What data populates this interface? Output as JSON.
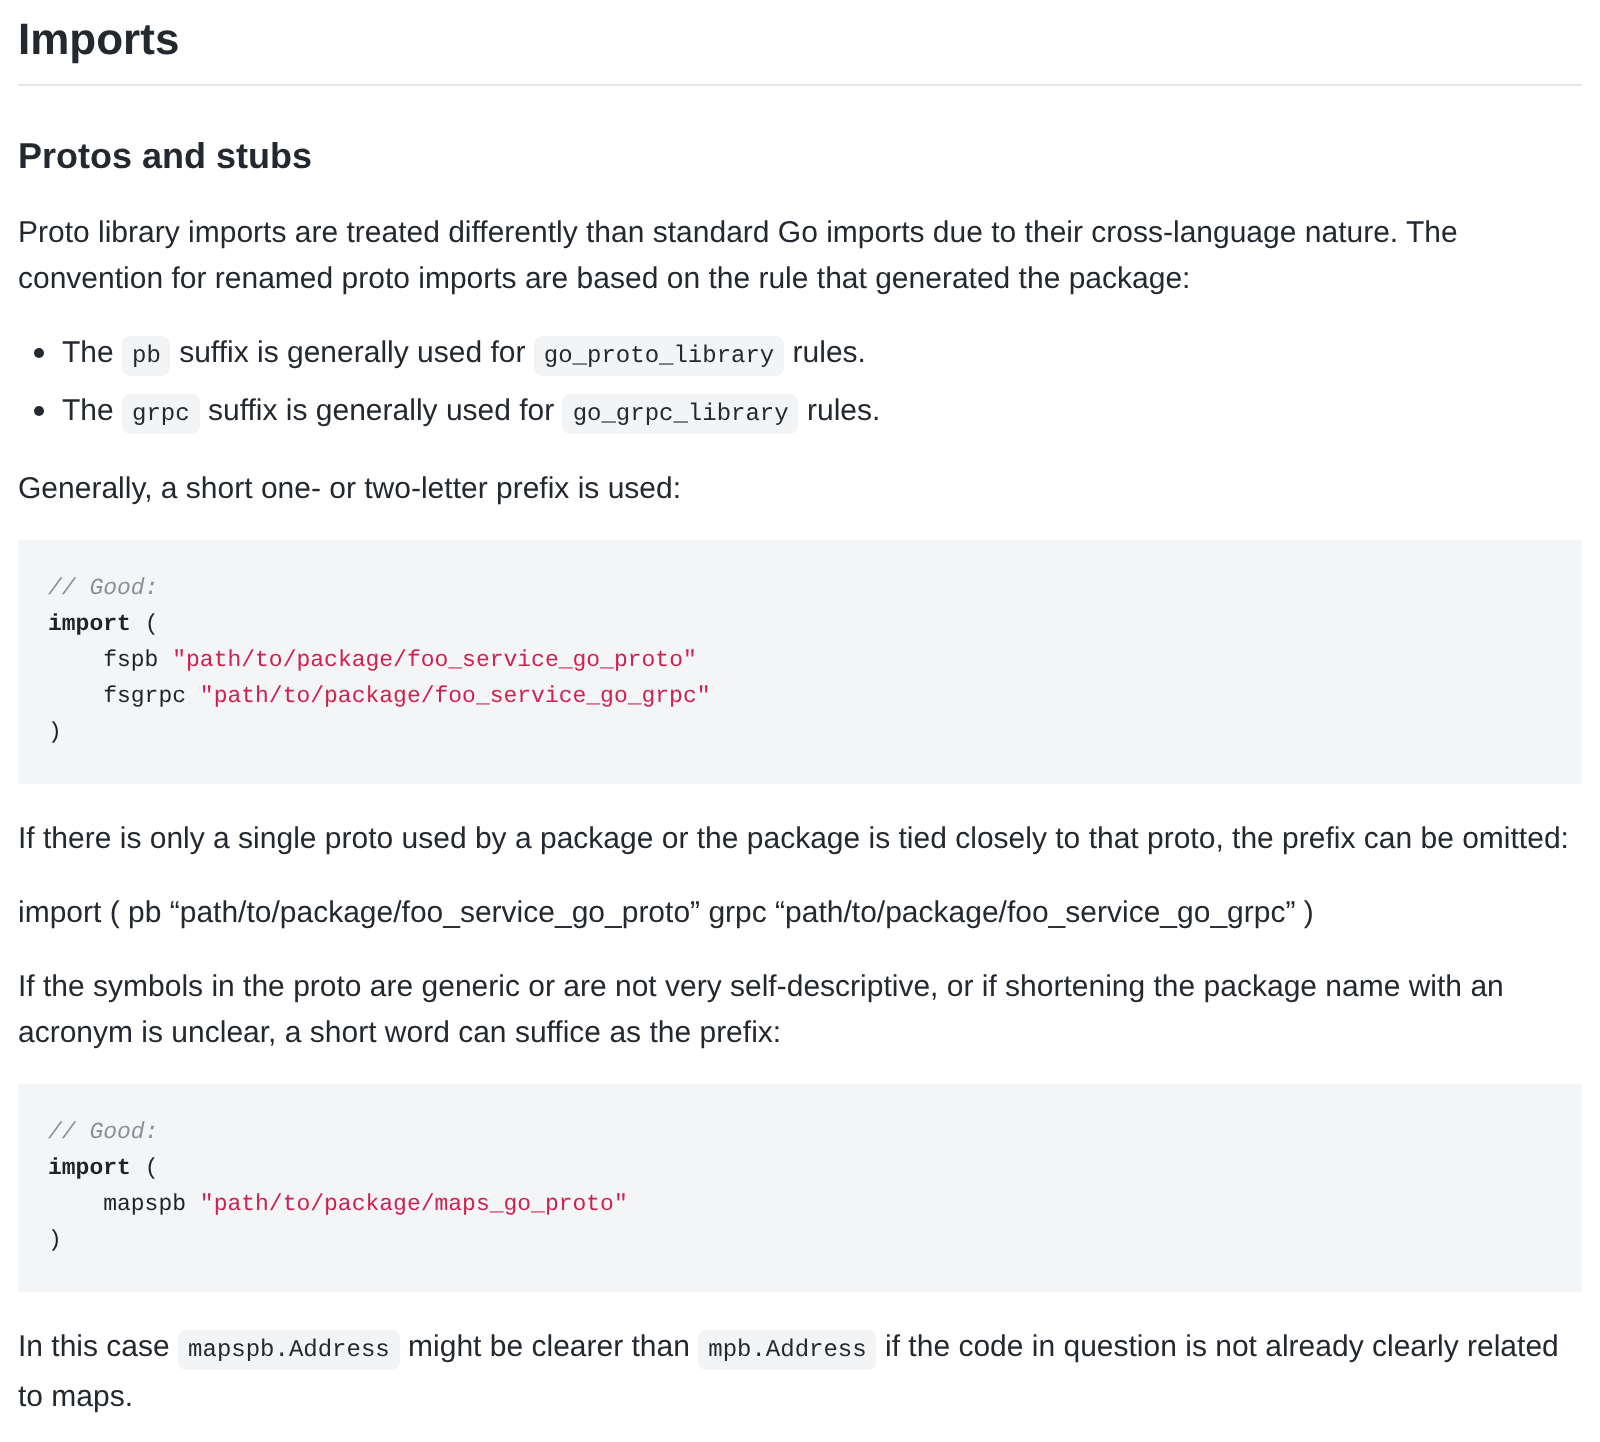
{
  "heading": "Imports",
  "subheading": "Protos and stubs",
  "blocks": [
    {
      "kind": "paragraph",
      "segments": [
        {
          "kind": "text",
          "text": "Proto library imports are treated differently than standard Go imports due to their cross-language nature. The convention for renamed proto imports are based on the rule that generated the package:"
        }
      ]
    },
    {
      "kind": "list",
      "items": [
        [
          {
            "kind": "text",
            "text": "The "
          },
          {
            "kind": "code",
            "text": "pb"
          },
          {
            "kind": "text",
            "text": " suffix is generally used for "
          },
          {
            "kind": "code",
            "text": "go_proto_library"
          },
          {
            "kind": "text",
            "text": " rules."
          }
        ],
        [
          {
            "kind": "text",
            "text": "The "
          },
          {
            "kind": "code",
            "text": "grpc"
          },
          {
            "kind": "text",
            "text": " suffix is generally used for "
          },
          {
            "kind": "code",
            "text": "go_grpc_library"
          },
          {
            "kind": "text",
            "text": " rules."
          }
        ]
      ]
    },
    {
      "kind": "paragraph",
      "segments": [
        {
          "kind": "text",
          "text": "Generally, a short one- or two-letter prefix is used:"
        }
      ]
    },
    {
      "kind": "code",
      "lines": [
        [
          {
            "kind": "comment",
            "text": "// Good:"
          }
        ],
        [
          {
            "kind": "keyword",
            "text": "import"
          },
          {
            "kind": "plain",
            "text": " ("
          }
        ],
        [
          {
            "kind": "plain",
            "text": "    fspb "
          },
          {
            "kind": "string",
            "text": "\"path/to/package/foo_service_go_proto\""
          }
        ],
        [
          {
            "kind": "plain",
            "text": "    fsgrpc "
          },
          {
            "kind": "string",
            "text": "\"path/to/package/foo_service_go_grpc\""
          }
        ],
        [
          {
            "kind": "plain",
            "text": ")"
          }
        ]
      ]
    },
    {
      "kind": "paragraph",
      "segments": [
        {
          "kind": "text",
          "text": "If there is only a single proto used by a package or the package is tied closely to that proto, the prefix can be omitted:"
        }
      ]
    },
    {
      "kind": "paragraph",
      "segments": [
        {
          "kind": "text",
          "text": "import ( pb “path/to/package/foo_service_go_proto” grpc “path/to/package/foo_service_go_grpc” )"
        }
      ]
    },
    {
      "kind": "paragraph",
      "segments": [
        {
          "kind": "text",
          "text": "If the symbols in the proto are generic or are not very self-descriptive, or if shortening the package name with an acronym is unclear, a short word can suffice as the prefix:"
        }
      ]
    },
    {
      "kind": "code",
      "lines": [
        [
          {
            "kind": "comment",
            "text": "// Good:"
          }
        ],
        [
          {
            "kind": "keyword",
            "text": "import"
          },
          {
            "kind": "plain",
            "text": " ("
          }
        ],
        [
          {
            "kind": "plain",
            "text": "    mapspb "
          },
          {
            "kind": "string",
            "text": "\"path/to/package/maps_go_proto\""
          }
        ],
        [
          {
            "kind": "plain",
            "text": ")"
          }
        ]
      ]
    },
    {
      "kind": "paragraph",
      "segments": [
        {
          "kind": "text",
          "text": "In this case "
        },
        {
          "kind": "code",
          "text": "mapspb.Address"
        },
        {
          "kind": "text",
          "text": " might be clearer than "
        },
        {
          "kind": "code",
          "text": "mpb.Address"
        },
        {
          "kind": "text",
          "text": " if the code in question is not already clearly related to maps."
        }
      ]
    }
  ]
}
